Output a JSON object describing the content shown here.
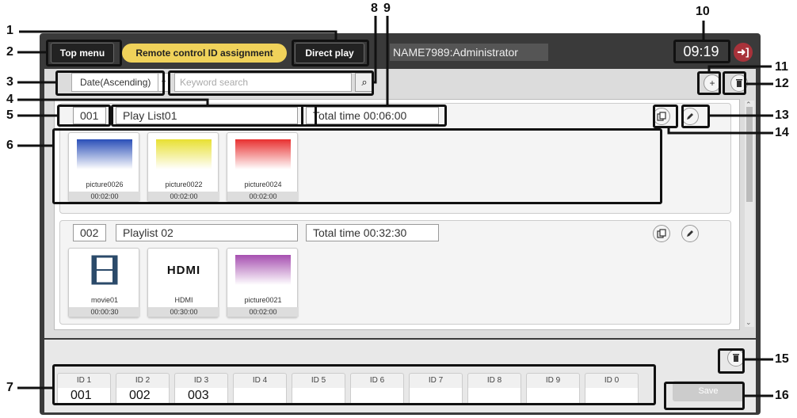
{
  "topbar": {
    "top_menu_label": "Top menu",
    "remote_id_label": "Remote control ID assignment",
    "direct_play_label": "Direct play",
    "user": "NAME7989:Administrator",
    "clock": "09:19",
    "logout_glyph": "➜]"
  },
  "toolbar": {
    "sort_value": "Date(Ascending)",
    "search_placeholder": "Keyword search",
    "search_icon": "⌕",
    "add_icon": "+",
    "delete_icon": "🗑"
  },
  "playlists": [
    {
      "number": "001",
      "name": "Play List01",
      "total_time": "Total time 00:06:00",
      "items": [
        {
          "name": "picture0026",
          "duration": "00:02:00"
        },
        {
          "name": "picture0022",
          "duration": "00:02:00"
        },
        {
          "name": "picture0024",
          "duration": "00:02:00"
        }
      ]
    },
    {
      "number": "002",
      "name": "Playlist 02",
      "total_time": "Total time 00:32:30",
      "items": [
        {
          "name": "movie01",
          "duration": "00:00:30"
        },
        {
          "name": "HDMI",
          "duration": "00:30:00",
          "logo": "HDMI"
        },
        {
          "name": "picture0021",
          "duration": "00:02:00"
        }
      ]
    }
  ],
  "id_slots": [
    {
      "label": "ID 1",
      "value": "001"
    },
    {
      "label": "ID 2",
      "value": "002"
    },
    {
      "label": "ID 3",
      "value": "003"
    },
    {
      "label": "ID 4",
      "value": ""
    },
    {
      "label": "ID 5",
      "value": ""
    },
    {
      "label": "ID 6",
      "value": ""
    },
    {
      "label": "ID 7",
      "value": ""
    },
    {
      "label": "ID 8",
      "value": ""
    },
    {
      "label": "ID 9",
      "value": ""
    },
    {
      "label": "ID 0",
      "value": ""
    }
  ],
  "save_label": "Save",
  "callouts": [
    "1",
    "2",
    "3",
    "4",
    "5",
    "6",
    "7",
    "8",
    "9",
    "10",
    "11",
    "12",
    "13",
    "14",
    "15",
    "16"
  ],
  "colors": {
    "accent_yellow": "#f0d25a",
    "logout_red": "#a8323a"
  }
}
